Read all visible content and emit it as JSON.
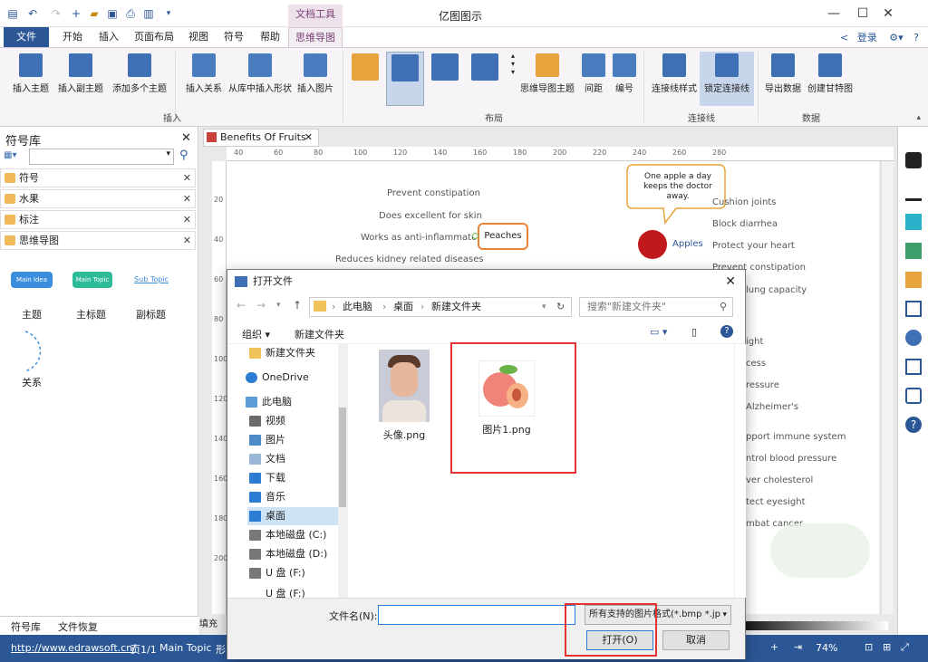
{
  "app": {
    "title": "亿图图示",
    "contextual_tab": "文档工具"
  },
  "tabs": [
    "文件",
    "开始",
    "插入",
    "页面布局",
    "视图",
    "符号",
    "帮助",
    "思维导图"
  ],
  "login": "登录",
  "ribbon": {
    "insert": [
      "插入主题",
      "插入副主题",
      "添加多个主题",
      "插入关系",
      "从库中插入形状",
      "插入图片"
    ],
    "layout": [
      "思维导图主题",
      "间距",
      "编号"
    ],
    "connector": [
      "连接线样式",
      "锁定连接线"
    ],
    "data": [
      "导出数据",
      "创建甘特图"
    ],
    "groups": [
      "插入",
      "布局",
      "连接线",
      "数据"
    ]
  },
  "library": {
    "title": "符号库",
    "items": [
      "符号",
      "水果",
      "标注",
      "思维导图"
    ],
    "shapes": [
      "Main Idea",
      "Main Topic",
      "Sub Topic"
    ],
    "shape_labels": [
      "主题",
      "主标题",
      "副标题",
      "关系"
    ],
    "bottom_tabs": [
      "符号库",
      "文件恢复"
    ]
  },
  "document": {
    "tab": "Benefits Of Fruits",
    "ruler_h": [
      "40",
      "60",
      "80",
      "100",
      "120",
      "140",
      "160",
      "180",
      "200",
      "220",
      "240",
      "260",
      "280"
    ],
    "ruler_v": [
      "20",
      "40",
      "60",
      "80",
      "100",
      "120",
      "140",
      "160",
      "180",
      "200"
    ],
    "peaches": {
      "label": "Peaches",
      "items": [
        "Prevent constipation",
        "Does excellent for skin",
        "Works as anti-inflammatory",
        "Reduces kidney related diseases"
      ]
    },
    "apples": {
      "label": "Apples",
      "callout": "One apple a day keeps the doctor away.",
      "items": [
        "Cushion joints",
        "Block diarrhea",
        "Protect your heart",
        "Prevent constipation",
        "lung capacity",
        "ight",
        "cess",
        "ressure",
        "Alzheimer's",
        "pport immune system",
        "ntrol blood pressure",
        "ver cholesterol",
        "tect eyesight",
        "mbat cancer"
      ]
    },
    "fill_label": "填充"
  },
  "dialog": {
    "title": "打开文件",
    "path": [
      "此电脑",
      "桌面",
      "新建文件夹"
    ],
    "search_placeholder": "搜索\"新建文件夹\"",
    "organize": "组织",
    "new_folder": "新建文件夹",
    "nav": [
      "新建文件夹",
      "OneDrive",
      "此电脑",
      "视频",
      "图片",
      "文档",
      "下载",
      "音乐",
      "桌面",
      "本地磁盘 (C:)",
      "本地磁盘 (D:)",
      "U 盘 (F:)",
      "U 盘 (F:)"
    ],
    "files": [
      {
        "name": "头像.png"
      },
      {
        "name": "图片1.png"
      }
    ],
    "filename_label": "文件名(N):",
    "filetype": "所有支持的图片格式(*.bmp *.jp",
    "open": "打开(O)",
    "cancel": "取消"
  },
  "status": {
    "url": "http://www.edrawsoft.cn/",
    "page": "页1/1",
    "topic": "Main Topic",
    "shape": "形",
    "zoom": "74%"
  },
  "colors": {
    "blue": "#2b5797",
    "mind_purple": "#7a3d74",
    "peach_green": "#69b848",
    "red_highlight": "#e53333"
  }
}
